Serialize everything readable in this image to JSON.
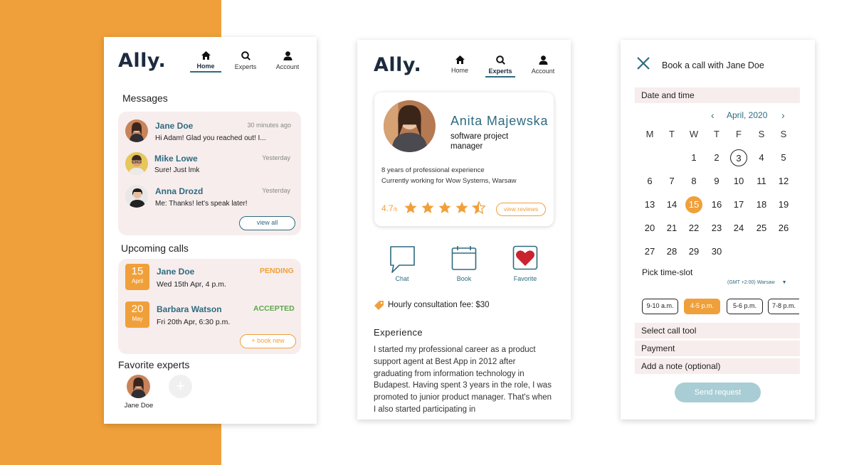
{
  "brand": {
    "logo": "Ally.",
    "accent": "#2e6b80",
    "orange": "#f0a03a",
    "pink": "#f7eded"
  },
  "nav": {
    "home": "Home",
    "experts": "Experts",
    "account": "Account"
  },
  "home": {
    "messages_title": "Messages",
    "messages": [
      {
        "name": "Jane Doe",
        "time": "30 minutes ago",
        "text": "Hi Adam! Glad you reached out! I..."
      },
      {
        "name": "Mike Lowe",
        "time": "Yesterday",
        "text": "Sure! Just lmk"
      },
      {
        "name": "Anna Drozd",
        "time": "Yesterday",
        "text": "Me: Thanks! let's speak later!"
      }
    ],
    "view_all": "view all",
    "calls_title": "Upcoming calls",
    "calls": [
      {
        "day": "15",
        "month": "April",
        "name": "Jane Doe",
        "when": "Wed 15th Apr, 4 p.m.",
        "status": "PENDING",
        "status_color": "#f0a03a"
      },
      {
        "day": "20",
        "month": "May",
        "name": "Barbara Watson",
        "when": "Fri 20th Apr, 6:30 p.m.",
        "status": "ACCEPTED",
        "status_color": "#5aa846"
      }
    ],
    "book_new": "+ book new",
    "favorites_title": "Favorite experts",
    "favorite_name": "Jane Doe"
  },
  "profile": {
    "name": "Anita Majewska",
    "role": "software project manager",
    "experience_line": "8 years of professional experience",
    "working_line": "Currently working for Wow Systems, Warsaw",
    "rating": "4.7",
    "rating_max": "/5",
    "rating_value": 4.5,
    "view_reviews": "view reviews",
    "actions": {
      "chat": "Chat",
      "book": "Book",
      "favorite": "Favorite"
    },
    "fee": "Hourly consultation fee: $30",
    "experience_title": "Experience",
    "experience_text": "I started my professional career as a product support agent at Best App in 2012 after graduating from information technology in Budapest. Having spent 3 years in the role, I was promoted to junior product manager. That's when I also started participating in"
  },
  "booking": {
    "title": "Book a call with Jane Doe",
    "date_time": "Date and time",
    "month": "April, 2020",
    "weekdays": [
      "M",
      "T",
      "W",
      "T",
      "F",
      "S",
      "S"
    ],
    "days": [
      "1",
      "2",
      "3",
      "4",
      "5",
      "6",
      "7",
      "8",
      "9",
      "10",
      "11",
      "12",
      "13",
      "14",
      "15",
      "16",
      "17",
      "18",
      "19",
      "20",
      "21",
      "22",
      "23",
      "24",
      "25",
      "26",
      "27",
      "28",
      "29",
      "30"
    ],
    "today": "3",
    "selected": "15",
    "pick_slot": "Pick time-slot",
    "timezone": "(GMT +2:00) Warsaw",
    "slots": [
      "9-10 a.m.",
      "4-5 p.m.",
      "5-6 p.m.",
      "7-8 p.m."
    ],
    "selected_slot": "4-5 p.m.",
    "select_tool": "Select call tool",
    "payment": "Payment",
    "add_note": "Add a note (optional)",
    "send": "Send request"
  }
}
